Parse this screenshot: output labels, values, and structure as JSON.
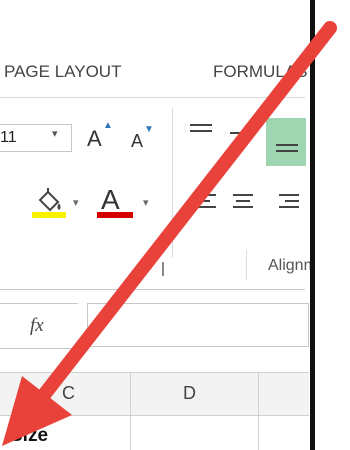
{
  "ribbon": {
    "tabs": [
      {
        "label": "PAGE LAYOUT"
      },
      {
        "label": "FORMULAS"
      }
    ],
    "font_size": "11",
    "alignment_group_label": "Alignment"
  },
  "formula_bar": {
    "fx_label": "fx"
  },
  "grid": {
    "columns": [
      "C",
      "D"
    ],
    "cell_text": "Size"
  },
  "colors": {
    "fill_color": "#f7f200",
    "font_color": "#d40000",
    "annotation_arrow": "#e8423b",
    "selected_align": "#9fd5b0"
  },
  "annotation": {
    "type": "arrow",
    "icon": "red-arrow-pointing-down-left"
  }
}
